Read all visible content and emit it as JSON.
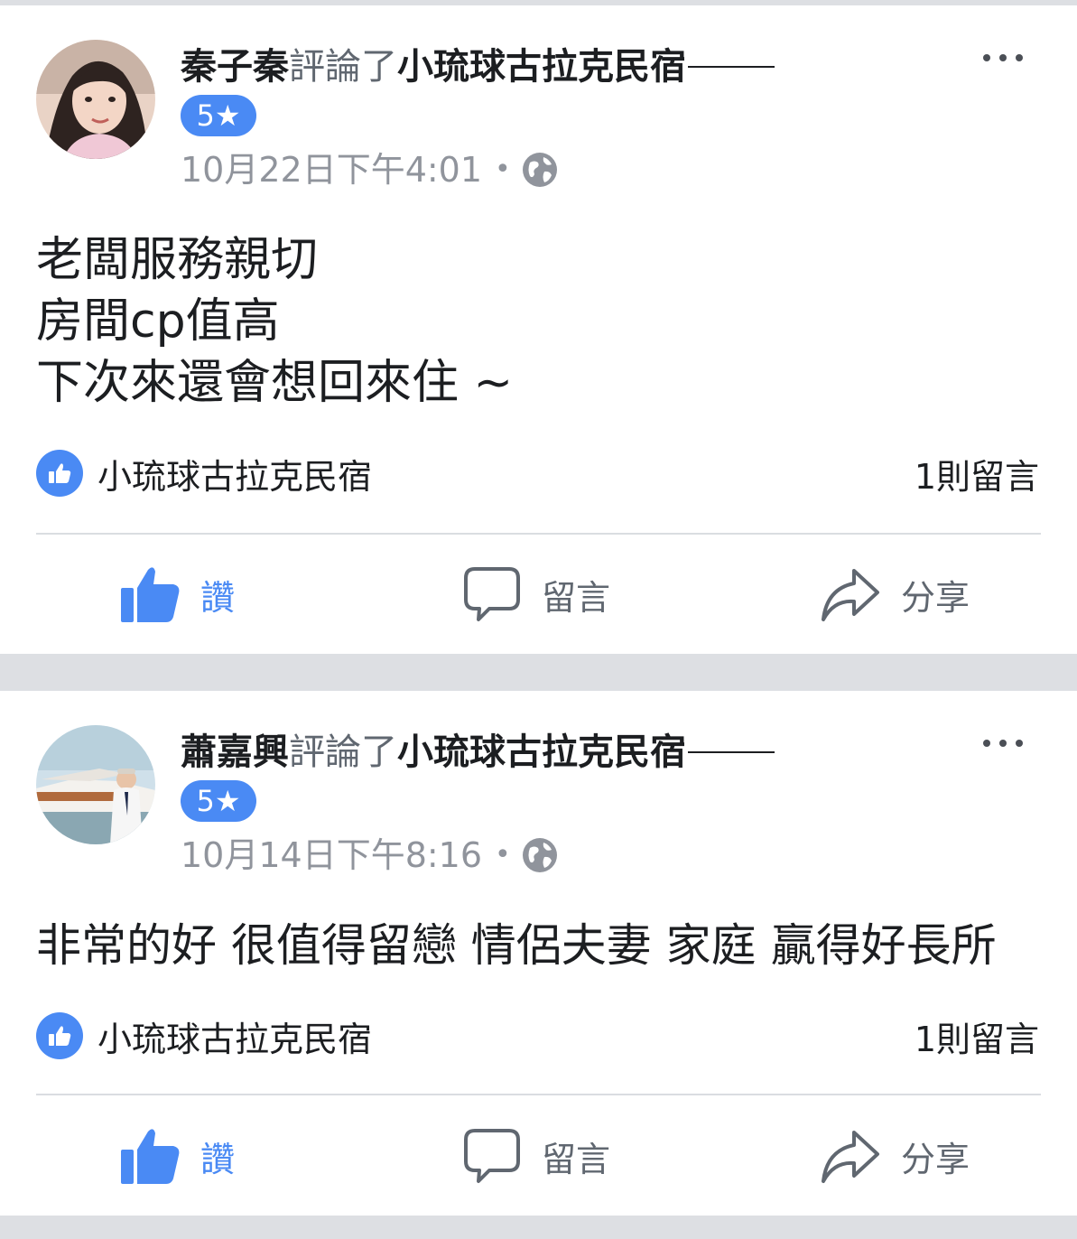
{
  "colors": {
    "accent": "#4a8af4",
    "background": "#dddfe3",
    "secondary_text": "#90949c"
  },
  "posts": [
    {
      "author": "秦子秦",
      "verb": "評論了",
      "page": "小琉球古拉克民宿",
      "rating": "5★",
      "timestamp": "10月22日下午4:01",
      "separator": "•",
      "privacy_icon": "globe-icon",
      "body": "老闆服務親切\n房間cp值高\n下次來還會想回來住 ~",
      "reply_page": "小琉球古拉克民宿",
      "reply_count": "1則留言",
      "actions": {
        "like": "讚",
        "comment": "留言",
        "share": "分享"
      }
    },
    {
      "author": "蕭嘉興",
      "verb": "評論了",
      "page": "小琉球古拉克民宿",
      "rating": "5★",
      "timestamp": "10月14日下午8:16",
      "separator": "•",
      "privacy_icon": "globe-icon",
      "body": "非常的好 很值得留戀 情侶夫妻 家庭 贏得好長所",
      "reply_page": "小琉球古拉克民宿",
      "reply_count": "1則留言",
      "actions": {
        "like": "讚",
        "comment": "留言",
        "share": "分享"
      }
    }
  ]
}
